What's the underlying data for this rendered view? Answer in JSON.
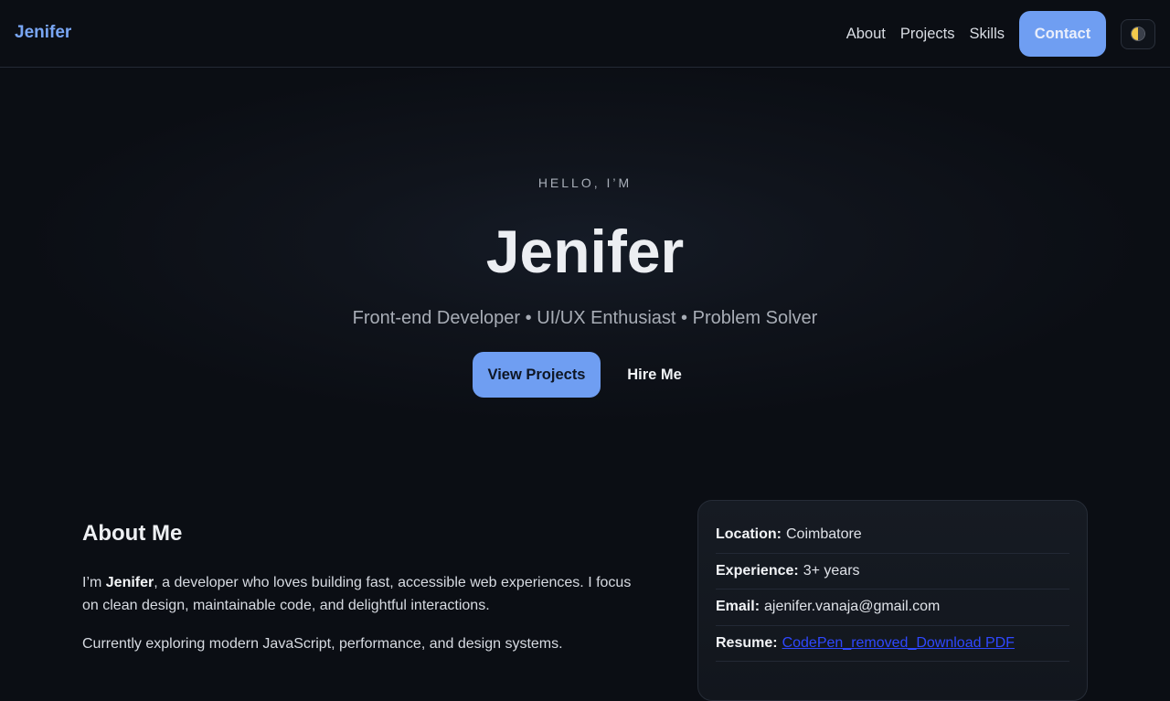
{
  "nav": {
    "brand": "Jenifer",
    "links": [
      "About",
      "Projects",
      "Skills"
    ],
    "contact_label": "Contact",
    "theme_toggle_icon": "half-moon-icon"
  },
  "hero": {
    "eyebrow": "HELLO, I’M",
    "title": "Jenifer",
    "subtitle": "Front-end Developer • UI/UX Enthusiast • Problem Solver",
    "primary_button": "View Projects",
    "secondary_button": "Hire Me"
  },
  "about": {
    "title": "About Me",
    "p1_prefix": "I’m ",
    "p1_name": "Jenifer",
    "p1_rest": ", a developer who loves building fast, accessible web experiences. I focus on clean design, maintainable code, and delightful interactions.",
    "p2": "Currently exploring modern JavaScript, performance, and design systems.",
    "info": {
      "location_label": "Location:",
      "location_value": "Coimbatore",
      "experience_label": "Experience:",
      "experience_value": "3+ years",
      "email_label": "Email:",
      "email_value": "ajenifer.vanaja@gmail.com",
      "resume_label": "Resume:",
      "resume_value": "CodePen_removed_Download PDF"
    }
  },
  "colors": {
    "accent": "#6f9ef2",
    "brand": "#79a6f4",
    "background": "#0b0e14",
    "link": "#2f48ff"
  }
}
